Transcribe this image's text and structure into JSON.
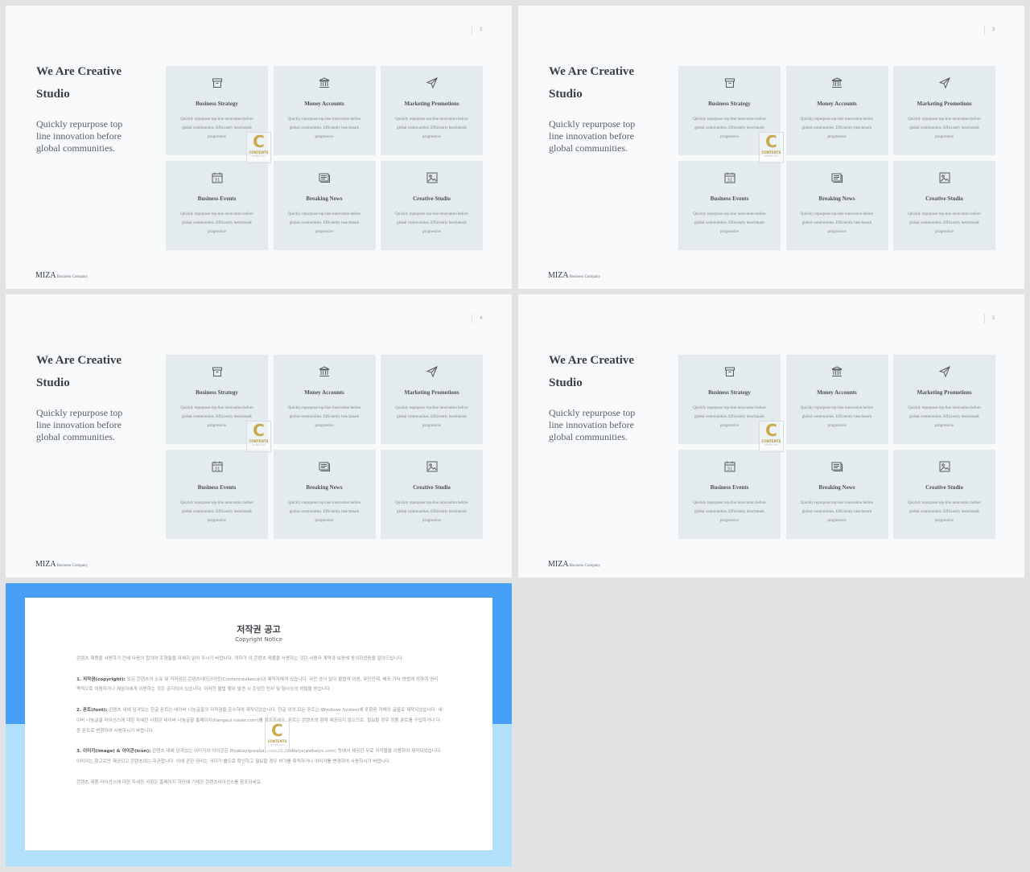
{
  "colors": {
    "slide_bg": "#f7f9fb",
    "card_bg": "#e4ebef",
    "notice_blue": "#479ff6",
    "notice_light_blue": "#b2e0fa",
    "watermark_gold": "#c9a94c"
  },
  "slides": [
    {
      "page": "2"
    },
    {
      "page": "3"
    },
    {
      "page": "4"
    },
    {
      "page": "5"
    }
  ],
  "slide_content": {
    "title": "We Are Creative Studio",
    "subtitle": "Quickly repurpose top line innovation before global communities.",
    "brand": "MIZA",
    "brand_tag": "Business Company",
    "cards": [
      {
        "icon": "archive-box-icon",
        "title": "Business Strategy",
        "text": "Quickly repurpose top-line innovation before global communities. Efficiently benchmark progressive"
      },
      {
        "icon": "bank-icon",
        "title": "Money Accounts",
        "text": "Quickly repurpose top-line innovation before global communities. Efficiently benchmark progressive"
      },
      {
        "icon": "paper-plane-icon",
        "title": "Marketing Promotions",
        "text": "Quickly repurpose top-line innovation before global communities. Efficiently benchmark progressive"
      },
      {
        "icon": "calendar-icon",
        "title": "Business Events",
        "text": "Quickly repurpose top-line innovation before global communities. Efficiently benchmark progressive"
      },
      {
        "icon": "newspaper-icon",
        "title": "Breaking News",
        "text": "Quickly repurpose top-line innovation before global communities. Efficiently benchmark progressive"
      },
      {
        "icon": "image-icon",
        "title": "Creative Studio",
        "text": "Quickly repurpose top-line innovation before global communities. Efficiently benchmark progressive"
      }
    ],
    "calendar_day": "31"
  },
  "watermark": {
    "letter": "C",
    "label": "CONTENTS",
    "sub": "STAKE OUT"
  },
  "notice": {
    "title": "저작권 공고",
    "subtitle": "Copyright Notice",
    "intro": "콘텐츠 제품을 사용하기 전에 다음의 합의와 조항들을 자세히 읽어 주시기 바랍니다. 귀하가 이 콘텐츠 제품을 사용하는 것은 사용자 계약과 보증에 동의하셨음을 알려드립니다.",
    "s1_head": "1. 저작권(copyright):",
    "s1_body": " 모든 콘텐츠의 소유 및 저작권은 콘텐츠테이크아웃(Contentstakeout)과 제작자에게 있습니다. 사전 승낙 없이 불법적 이용, 무단전재, 배포 기타 방법에 의하여 영리 목적으로 이용하거나 제삼자에게 이용하는 것은 금지되어 있습니다. 이러한 불법 행위 발견 시 준엄한 민사 및 형사상의 처벌을 받습니다.",
    "s2_head": "2. 폰트(font):",
    "s2_body": " 콘텐츠 내에 담겨있는 한글 폰트는 네이버 나눔글꼴의 저작권을 준수하여 제작되었습니다. 한글 외의 모든 폰트는 Windows System에 포함된 자체의 글꼴로 제작되었습니다. 네이버 나눔글꼴 라이선스에 대한 자세한 사항은 네이버 나눔글꼴 홈페이지(hangeul.naver.com)를 참조하세요. 폰트는 콘텐츠와 함께 제공되지 않으므로, 필요할 경우 정품 폰트를 구입하거나 다른 폰트로 변경하여 사용하시기 바랍니다.",
    "s3_head": "3. 이미지(image) & 아이콘(icon):",
    "s3_body": " 콘텐츠 내에 담겨있는 이미지와 아이콘은 Pixabay(pixabay.com)와 Webalys(webalys.com) 등에서 제공한 무료 저작물을 이용하여 제작되었습니다. 이미지는 참고로만 제공되고 콘텐츠와는 무관합니다. 이에 관한 권리는 귀하가 별도로 확인하고 필요할 경우 허가를 취득하거나 이미지를 변경하여 사용하시기 바랍니다.",
    "footer": "콘텐츠 제품 라이선스에 대한 자세한 사항은 홈페이지 하단에 기재한 콘텐츠라이선스를 참조하세요."
  }
}
